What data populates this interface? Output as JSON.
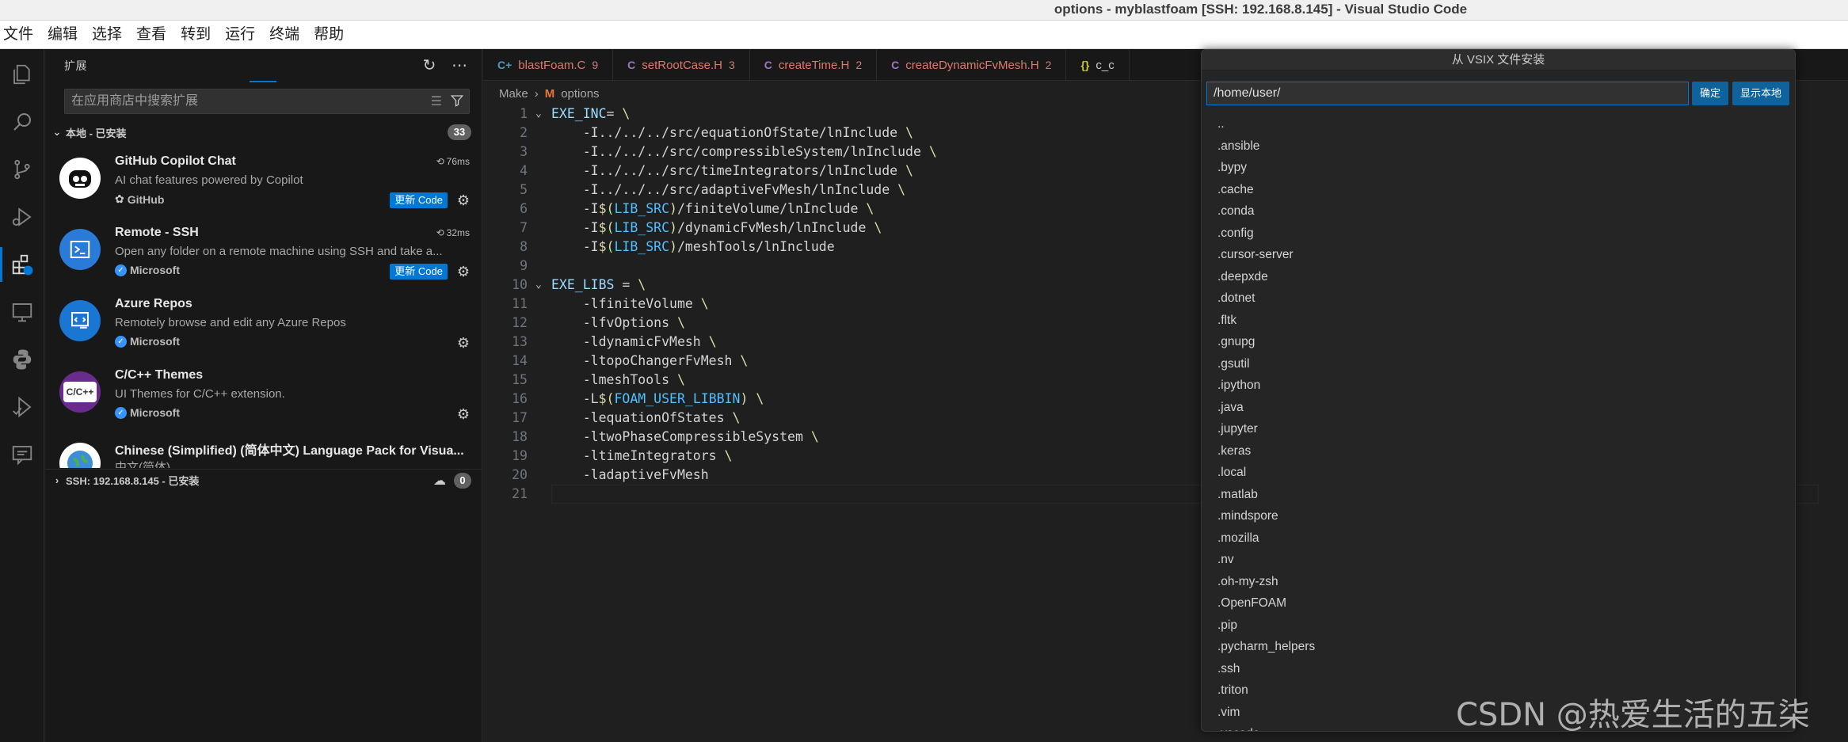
{
  "window": {
    "title": "options - myblastfoam [SSH: 192.168.8.145] - Visual Studio Code"
  },
  "menu": [
    "文件",
    "编辑",
    "选择",
    "查看",
    "转到",
    "运行",
    "终端",
    "帮助"
  ],
  "activity_icons": [
    "explorer-icon",
    "search-icon",
    "source-control-icon",
    "run-debug-icon",
    "extensions-icon",
    "remote-explorer-icon",
    "python-icon",
    "testing-icon",
    "chat-icon"
  ],
  "sidebar": {
    "title": "扩展",
    "search_placeholder": "在应用商店中搜索扩展",
    "section_local": "本地 - 已安装",
    "section_local_count": "33",
    "section_ssh": "SSH: 192.168.8.145 - 已安装",
    "section_ssh_count": "0",
    "extensions": [
      {
        "name": "GitHub Copilot Chat",
        "desc": "AI chat features powered by Copilot",
        "publisher": "GitHub",
        "time": "76ms",
        "update": "更新 Code",
        "verified": false
      },
      {
        "name": "Remote - SSH",
        "desc": "Open any folder on a remote machine using SSH and take a...",
        "publisher": "Microsoft",
        "time": "32ms",
        "update": "更新 Code",
        "verified": true
      },
      {
        "name": "Azure Repos",
        "desc": "Remotely browse and edit any Azure Repos",
        "publisher": "Microsoft",
        "time": "",
        "update": "",
        "verified": true
      },
      {
        "name": "C/C++ Themes",
        "desc": "UI Themes for C/C++ extension.",
        "publisher": "Microsoft",
        "time": "",
        "update": "",
        "verified": true
      },
      {
        "name": "Chinese (Simplified) (简体中文) Language Pack for Visua...",
        "desc": "中文(简体)",
        "publisher": "",
        "time": "",
        "update": "",
        "verified": false
      }
    ]
  },
  "editor": {
    "tabs": [
      {
        "lang": "C+",
        "name": "blastFoam.C",
        "count": "9"
      },
      {
        "lang": "C",
        "name": "setRootCase.H",
        "count": "3"
      },
      {
        "lang": "C",
        "name": "createTime.H",
        "count": "2"
      },
      {
        "lang": "C",
        "name": "createDynamicFvMesh.H",
        "count": "2"
      },
      {
        "lang": "{}",
        "name": "c_c",
        "count": ""
      }
    ],
    "breadcrumb": {
      "folder": "Make",
      "file": "options"
    },
    "lines": [
      "EXE_INC= \\",
      "    -I../../../src/equationOfState/lnInclude \\",
      "    -I../../../src/compressibleSystem/lnInclude \\",
      "    -I../../../src/timeIntegrators/lnInclude \\",
      "    -I../../../src/adaptiveFvMesh/lnInclude \\",
      "    -I$(LIB_SRC)/finiteVolume/lnInclude \\",
      "    -I$(LIB_SRC)/dynamicFvMesh/lnInclude \\",
      "    -I$(LIB_SRC)/meshTools/lnInclude",
      "",
      "EXE_LIBS = \\",
      "    -lfiniteVolume \\",
      "    -lfvOptions \\",
      "    -ldynamicFvMesh \\",
      "    -ltopoChangerFvMesh \\",
      "    -lmeshTools \\",
      "    -L$(FOAM_USER_LIBBIN) \\",
      "    -lequationOfStates \\",
      "    -ltwoPhaseCompressibleSystem \\",
      "    -ltimeIntegrators \\",
      "    -ladaptiveFvMesh",
      ""
    ]
  },
  "quick_input": {
    "title": "从 VSIX 文件安装",
    "value": "/home/user/",
    "ok_label": "确定",
    "show_local_label": "显示本地",
    "items": [
      "..",
      ".ansible",
      ".bypy",
      ".cache",
      ".conda",
      ".config",
      ".cursor-server",
      ".deepxde",
      ".dotnet",
      ".fltk",
      ".gnupg",
      ".gsutil",
      ".ipython",
      ".java",
      ".jupyter",
      ".keras",
      ".local",
      ".matlab",
      ".mindspore",
      ".mozilla",
      ".nv",
      ".oh-my-zsh",
      ".OpenFOAM",
      ".pip",
      ".pycharm_helpers",
      ".ssh",
      ".triton",
      ".vim",
      ".vscode"
    ]
  },
  "watermark": "CSDN @热爱生活的五柒",
  "colors": {
    "accent": "#0078d4",
    "tab_text": "#e0786b",
    "background": "#1f1f1f"
  }
}
